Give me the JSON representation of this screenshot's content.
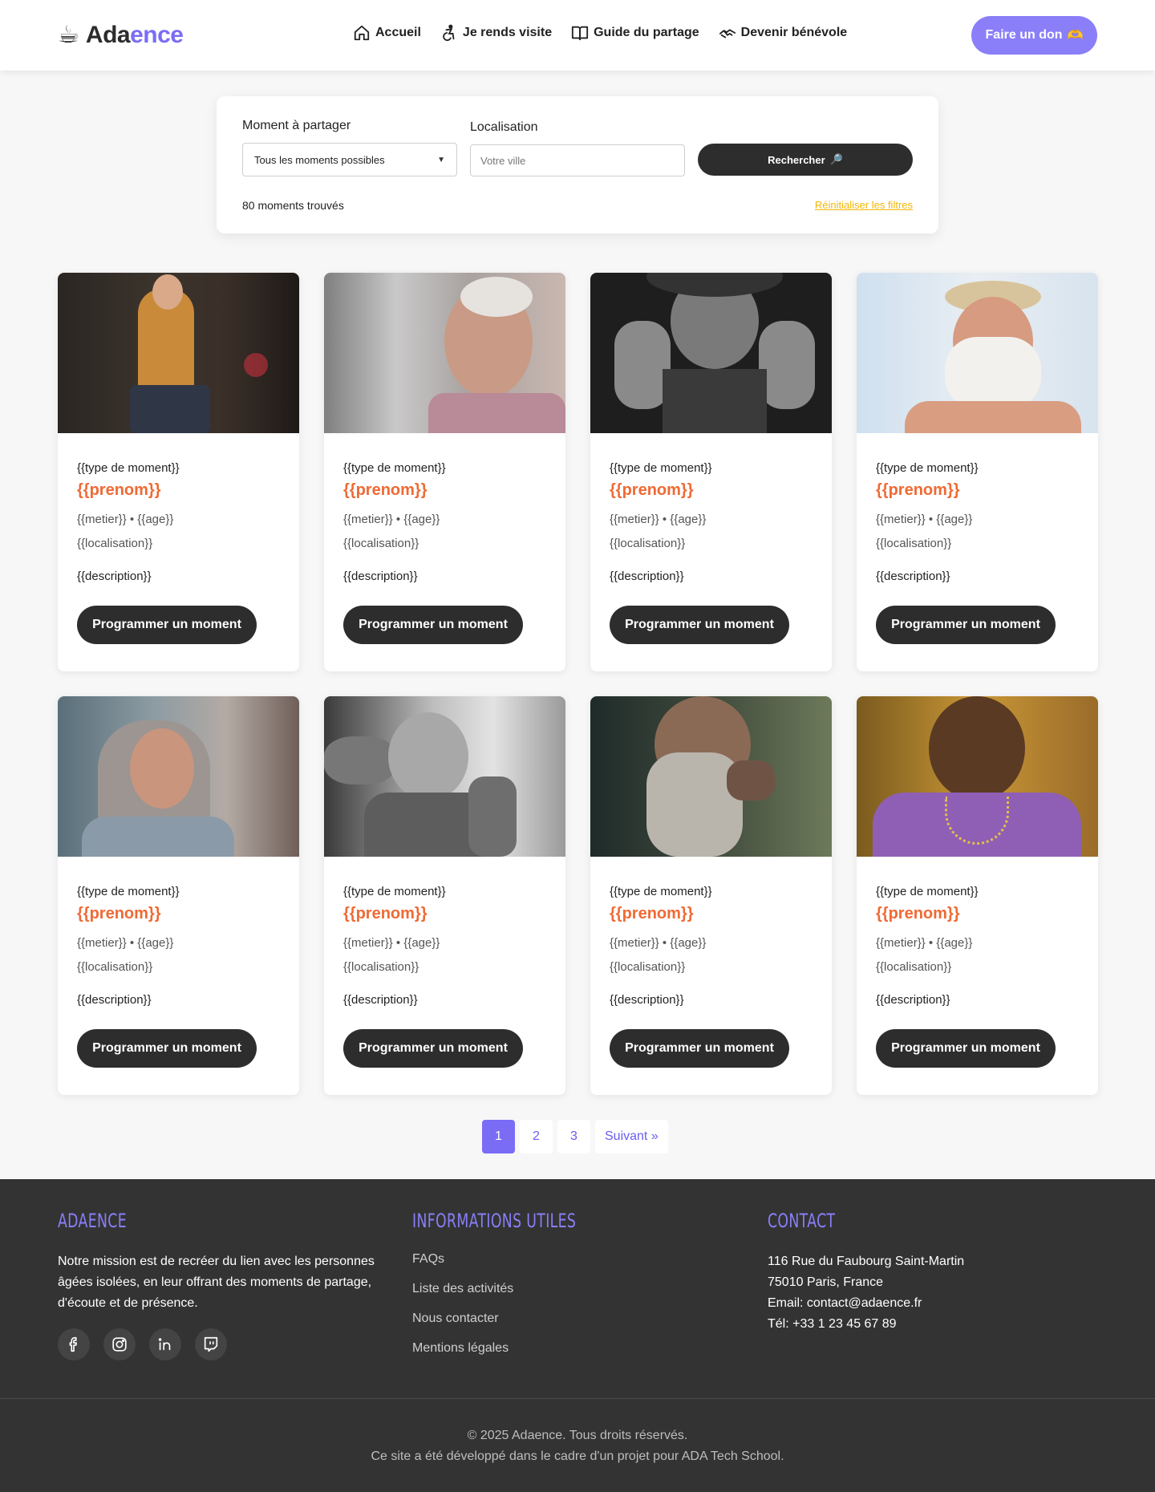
{
  "header": {
    "logo_icon": "☕",
    "logo_prefix": "Ada",
    "logo_suffix": "ence",
    "nav": [
      {
        "label": "Accueil",
        "icon": "home-icon"
      },
      {
        "label": "Je rends visite",
        "icon": "accessibility-icon"
      },
      {
        "label": "Guide du partage",
        "icon": "book-icon"
      },
      {
        "label": "Devenir bénévole",
        "icon": "handshake-icon"
      }
    ],
    "donate_label": "Faire un don",
    "donate_emoji": "🫶"
  },
  "search": {
    "moment_label": "Moment à partager",
    "moment_selected": "Tous les moments possibles",
    "location_label": "Localisation",
    "location_placeholder": "Votre ville",
    "submit_label": "Rechercher",
    "submit_icon": "🔎",
    "result_count": "80 moments trouvés",
    "reset_label": "Réinitialiser les filtres"
  },
  "cards": [
    {
      "type": "{{type de moment}}",
      "name": "{{prenom}}",
      "meta1": "{{metier}} • {{age}}",
      "meta2": "{{localisation}}",
      "desc": "{{description}}",
      "cta": "Programmer un moment"
    },
    {
      "type": "{{type de moment}}",
      "name": "{{prenom}}",
      "meta1": "{{metier}} • {{age}}",
      "meta2": "{{localisation}}",
      "desc": "{{description}}",
      "cta": "Programmer un moment"
    },
    {
      "type": "{{type de moment}}",
      "name": "{{prenom}}",
      "meta1": "{{metier}} • {{age}}",
      "meta2": "{{localisation}}",
      "desc": "{{description}}",
      "cta": "Programmer un moment"
    },
    {
      "type": "{{type de moment}}",
      "name": "{{prenom}}",
      "meta1": "{{metier}} • {{age}}",
      "meta2": "{{localisation}}",
      "desc": "{{description}}",
      "cta": "Programmer un moment"
    },
    {
      "type": "{{type de moment}}",
      "name": "{{prenom}}",
      "meta1": "{{metier}} • {{age}}",
      "meta2": "{{localisation}}",
      "desc": "{{description}}",
      "cta": "Programmer un moment"
    },
    {
      "type": "{{type de moment}}",
      "name": "{{prenom}}",
      "meta1": "{{metier}} • {{age}}",
      "meta2": "{{localisation}}",
      "desc": "{{description}}",
      "cta": "Programmer un moment"
    },
    {
      "type": "{{type de moment}}",
      "name": "{{prenom}}",
      "meta1": "{{metier}} • {{age}}",
      "meta2": "{{localisation}}",
      "desc": "{{description}}",
      "cta": "Programmer un moment"
    },
    {
      "type": "{{type de moment}}",
      "name": "{{prenom}}",
      "meta1": "{{metier}} • {{age}}",
      "meta2": "{{localisation}}",
      "desc": "{{description}}",
      "cta": "Programmer un moment"
    }
  ],
  "pagination": {
    "pages": [
      "1",
      "2",
      "3"
    ],
    "current": "1",
    "next_label": "Suivant »"
  },
  "footer": {
    "brand_title": "ADAENCE",
    "mission": "Notre mission est de recréer du lien avec les personnes âgées isolées, en leur offrant des moments de partage, d'écoute et de présence.",
    "socials": [
      "facebook-icon",
      "instagram-icon",
      "linkedin-icon",
      "twitch-icon"
    ],
    "info_title": "INFORMATIONS UTILES",
    "info_links": [
      "FAQs",
      "Liste des activités",
      "Nous contacter",
      "Mentions légales"
    ],
    "contact_title": "CONTACT",
    "contact_lines": [
      "116 Rue du Faubourg Saint-Martin",
      "75010 Paris, France",
      "Email: contact@adaence.fr",
      "Tél: +33 1 23 45 67 89"
    ],
    "copyright": "© 2025 Adaence. Tous droits réservés.",
    "credit": "Ce site a été développé dans le cadre d'un projet pour ADA Tech School."
  },
  "colors": {
    "accent": "#7b6cf6",
    "name_orange": "#ef6a34",
    "reset_yellow": "#f2b705",
    "dark_button": "#2d2d2d",
    "footer_bg": "#333333"
  }
}
